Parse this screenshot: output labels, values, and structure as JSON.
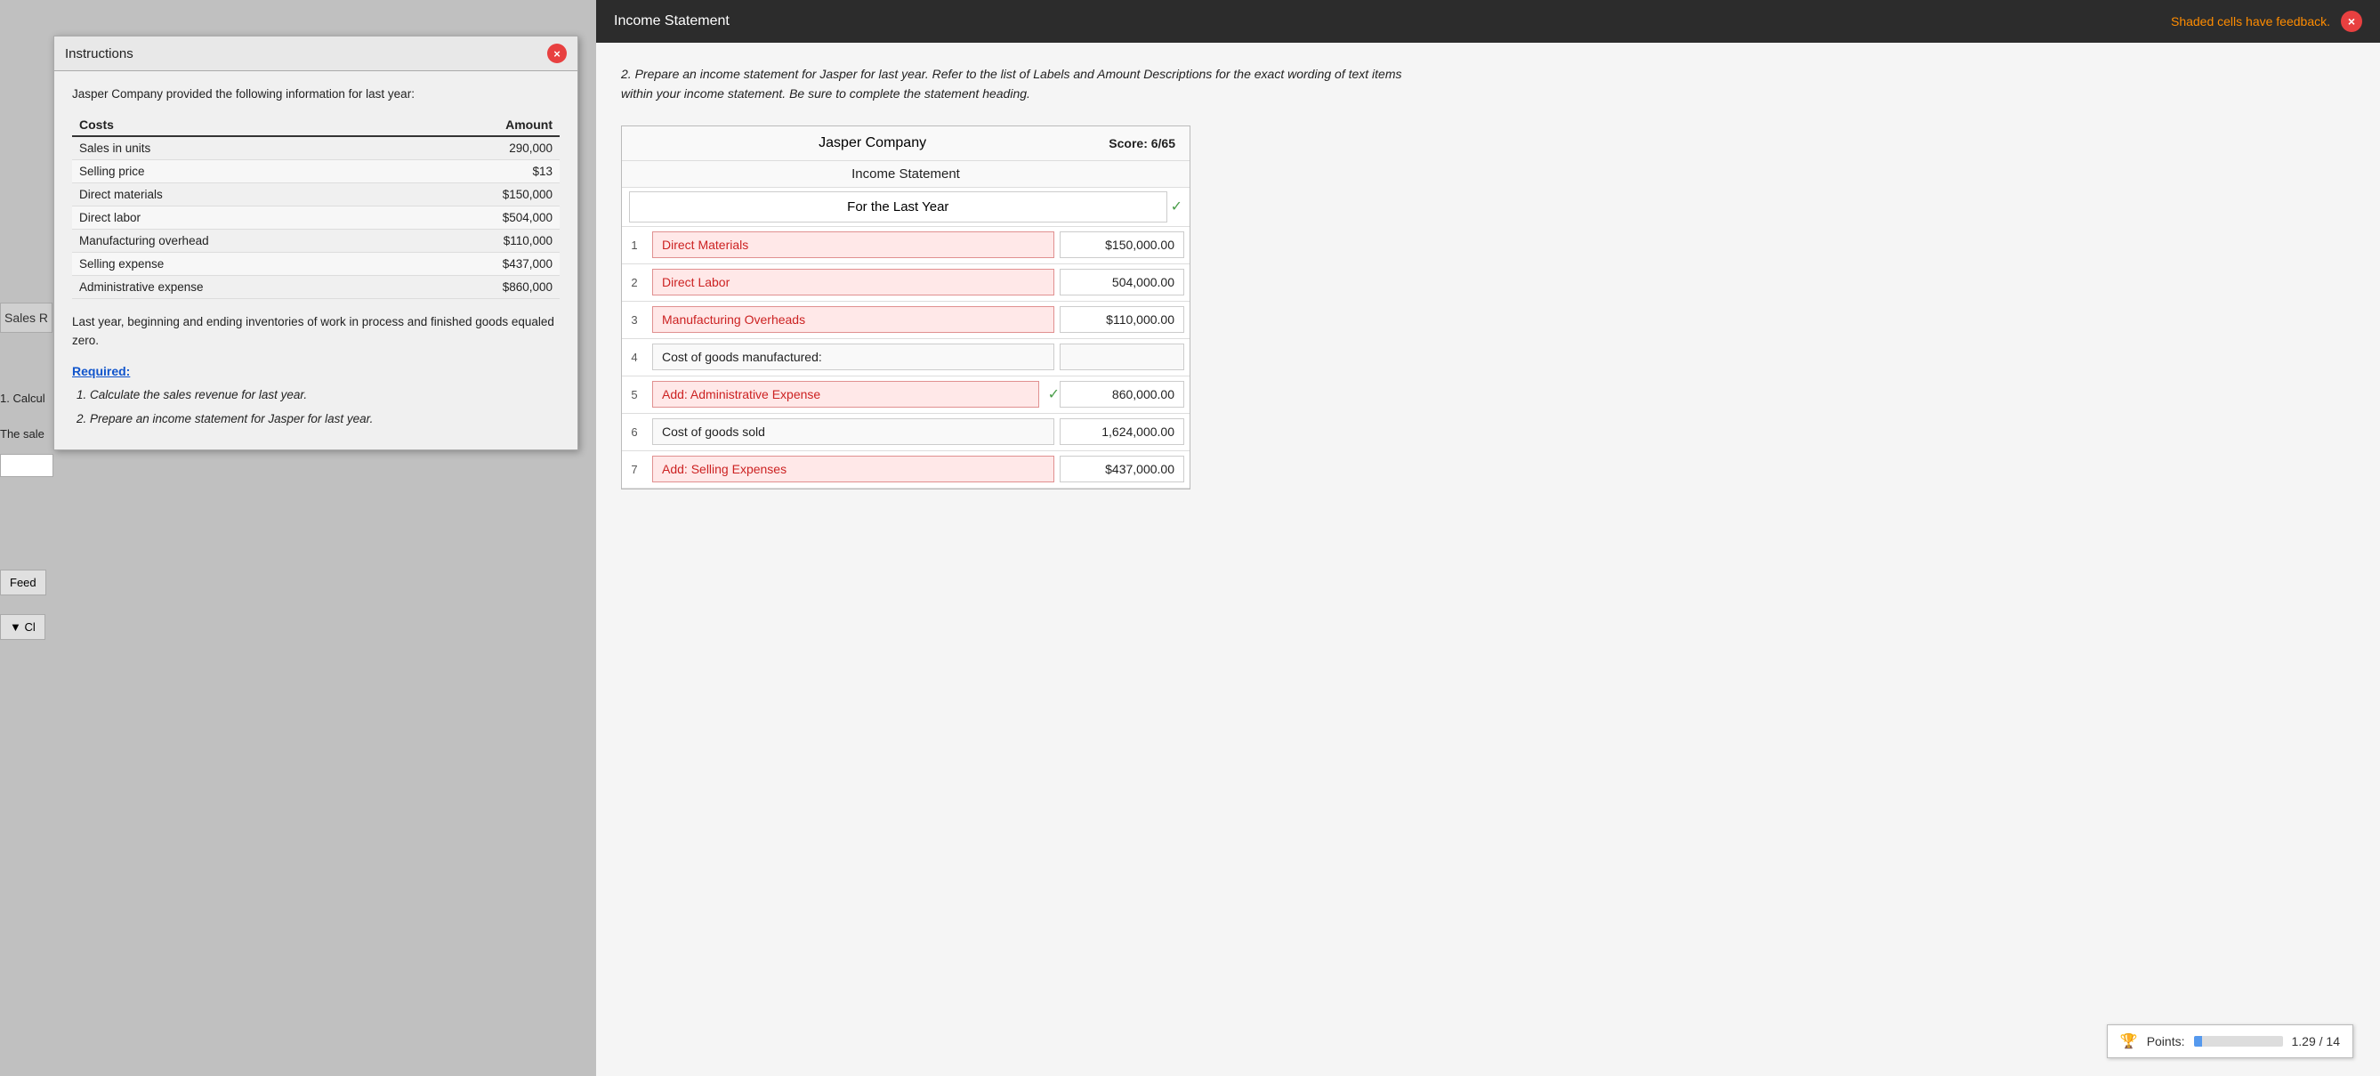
{
  "instructions": {
    "title": "Instructions",
    "intro": "Jasper Company provided the following information for last year:",
    "costs_header": "Costs",
    "amount_header": "Amount",
    "table_rows": [
      {
        "cost": "Sales in units",
        "amount": "290,000"
      },
      {
        "cost": "Selling price",
        "amount": "$13"
      },
      {
        "cost": "Direct materials",
        "amount": "$150,000"
      },
      {
        "cost": "Direct labor",
        "amount": "$504,000"
      },
      {
        "cost": "Manufacturing overhead",
        "amount": "$110,000"
      },
      {
        "cost": "Selling expense",
        "amount": "$437,000"
      },
      {
        "cost": "Administrative expense",
        "amount": "$860,000"
      }
    ],
    "inventory_note": "Last year, beginning and ending inventories of work in process and finished goods equaled zero.",
    "required_label": "Required:",
    "required_items": [
      "Calculate the sales revenue for last year.",
      "Prepare an income statement for Jasper for last year."
    ],
    "close_label": "×"
  },
  "left_sidebar": {
    "sales_r": "Sales R",
    "calc_label": "1. Calcul",
    "the_sale_label": "The sale",
    "feed_label": "Feed",
    "collapse_label": "▼ Cl"
  },
  "income_statement": {
    "window_title": "Income Statement",
    "feedback_notice": "Shaded cells have feedback.",
    "close_label": "×",
    "instruction_text": "2. Prepare an income statement for Jasper for last year. Refer to the list of Labels and Amount Descriptions for the exact wording of text items within your income statement. Be sure to complete the statement heading.",
    "company_name": "Jasper Company",
    "statement_name": "Income Statement",
    "score_label": "Score: 6/65",
    "period": "For the Last Year",
    "rows": [
      {
        "num": "1",
        "label": "Direct Materials",
        "amount": "$150,000.00",
        "label_pink": true,
        "amount_pink": false
      },
      {
        "num": "2",
        "label": "Direct Labor",
        "amount": "504,000.00",
        "label_pink": true,
        "amount_pink": false
      },
      {
        "num": "3",
        "label": "Manufacturing Overheads",
        "amount": "$110,000.00",
        "label_pink": true,
        "amount_pink": false
      },
      {
        "num": "4",
        "label": "Cost of goods manufactured:",
        "amount": "",
        "label_pink": false,
        "amount_pink": false
      },
      {
        "num": "5",
        "label": "Add: Administrative Expense",
        "amount": "860,000.00",
        "label_pink": true,
        "amount_pink": false,
        "checkmark": true
      },
      {
        "num": "6",
        "label": "Cost of goods sold",
        "amount": "1,624,000.00",
        "label_pink": false,
        "amount_pink": false
      },
      {
        "num": "7",
        "label": "Add: Selling Expenses",
        "amount": "$437,000.00",
        "label_pink": true,
        "amount_pink": false
      }
    ]
  },
  "points": {
    "label": "Points:",
    "value": "1.29 / 14",
    "fill_percent": 9
  }
}
